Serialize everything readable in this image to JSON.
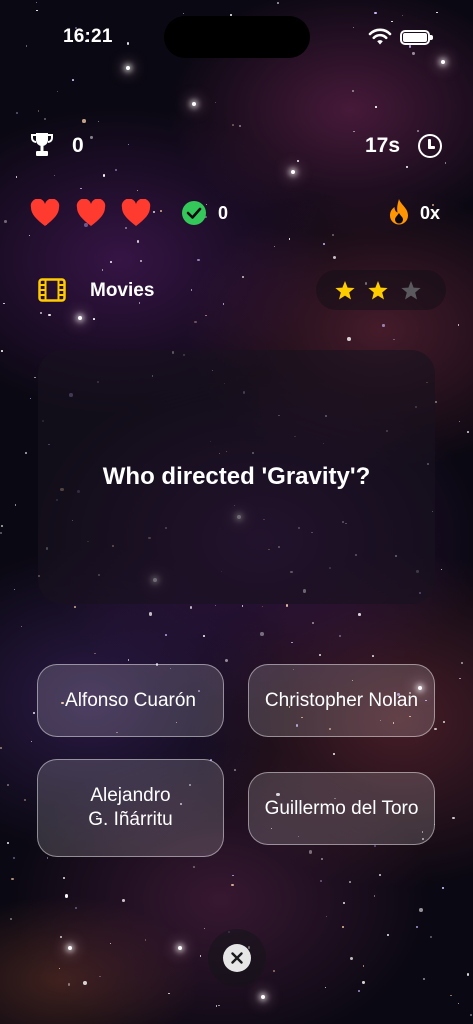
{
  "status_bar": {
    "time": "16:21",
    "icons": [
      "wifi-icon",
      "battery-icon"
    ]
  },
  "stats": {
    "score": "0",
    "timer": "17s",
    "lives": 3,
    "correct_count": "0",
    "streak": "0x"
  },
  "category": {
    "icon": "film-icon",
    "name": "Movies"
  },
  "difficulty": {
    "filled_stars": 2,
    "total_stars": 3
  },
  "question": {
    "text": "Who directed 'Gravity'?"
  },
  "answers": [
    {
      "label": "Alfonso Cuarón"
    },
    {
      "label": "Christopher Nolan"
    },
    {
      "label": "Alejandro\nG. Iñárritu"
    },
    {
      "label": "Guillermo del Toro"
    }
  ],
  "colors": {
    "heart": "#ff3b30",
    "check": "#34c759",
    "flame": "#ff9500",
    "star_filled": "#ffcc00",
    "star_empty": "#5a5a5e",
    "film": "#ffcc00"
  }
}
